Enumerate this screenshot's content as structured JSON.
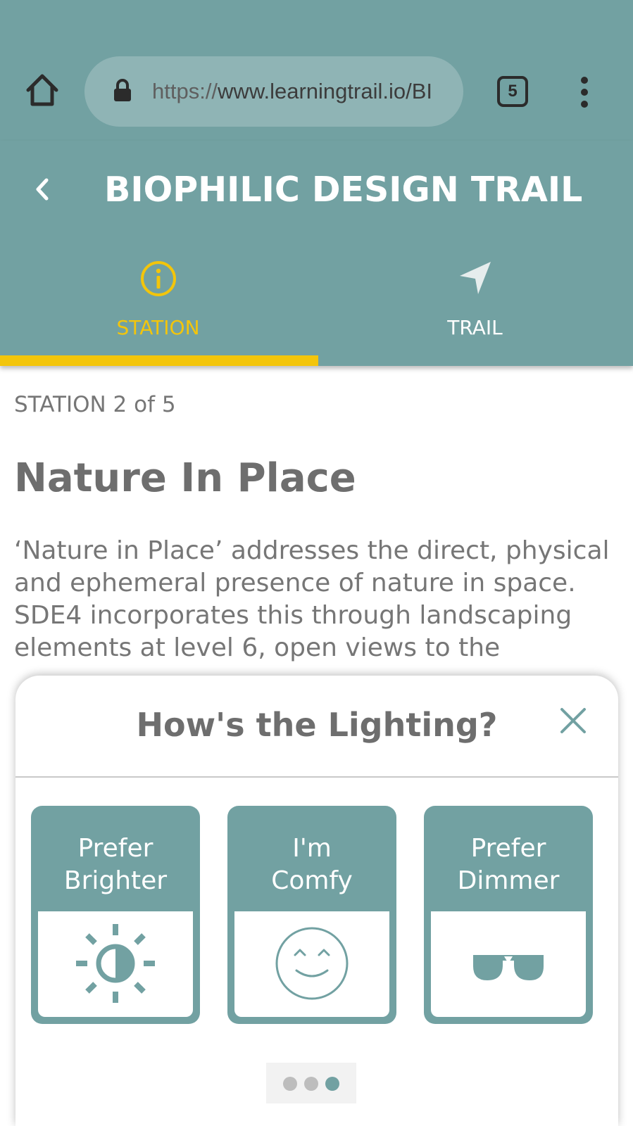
{
  "browser": {
    "url_scheme": "https://",
    "url_rest": "www.learningtrail.io/BI",
    "tab_count": "5",
    "icons": {
      "home": "home-icon",
      "lock": "lock-icon",
      "menu": "more-vertical-icon"
    }
  },
  "header": {
    "title": "BIOPHILIC DESIGN TRAIL",
    "back_icon": "chevron-left-icon"
  },
  "tabs": [
    {
      "label": "STATION",
      "icon": "info-icon",
      "active": true
    },
    {
      "label": "TRAIL",
      "icon": "navigation-arrow-icon",
      "active": false
    }
  ],
  "station": {
    "count": "STATION 2 of 5",
    "title": "Nature In Place",
    "body_lines": [
      "‘Nature in Place’ addresses the direct, physical",
      "and ephemeral presence of nature in space.",
      "SDE4 incorporates this through landscaping",
      "elements at level 6, open views to the"
    ]
  },
  "feedback": {
    "title": "How's the Lighting?",
    "options": [
      {
        "line1": "Prefer",
        "line2": "Brighter",
        "icon": "brightness-icon"
      },
      {
        "line1": "I'm",
        "line2": "Comfy",
        "icon": "smiley-icon"
      },
      {
        "line1": "Prefer",
        "line2": "Dimmer",
        "icon": "sunglasses-icon"
      }
    ],
    "pager": {
      "pages": 3,
      "current": 3
    }
  },
  "colors": {
    "primary": "#72a1a2",
    "accent": "#f3c50b",
    "text_gray": "#6e6e6e"
  }
}
